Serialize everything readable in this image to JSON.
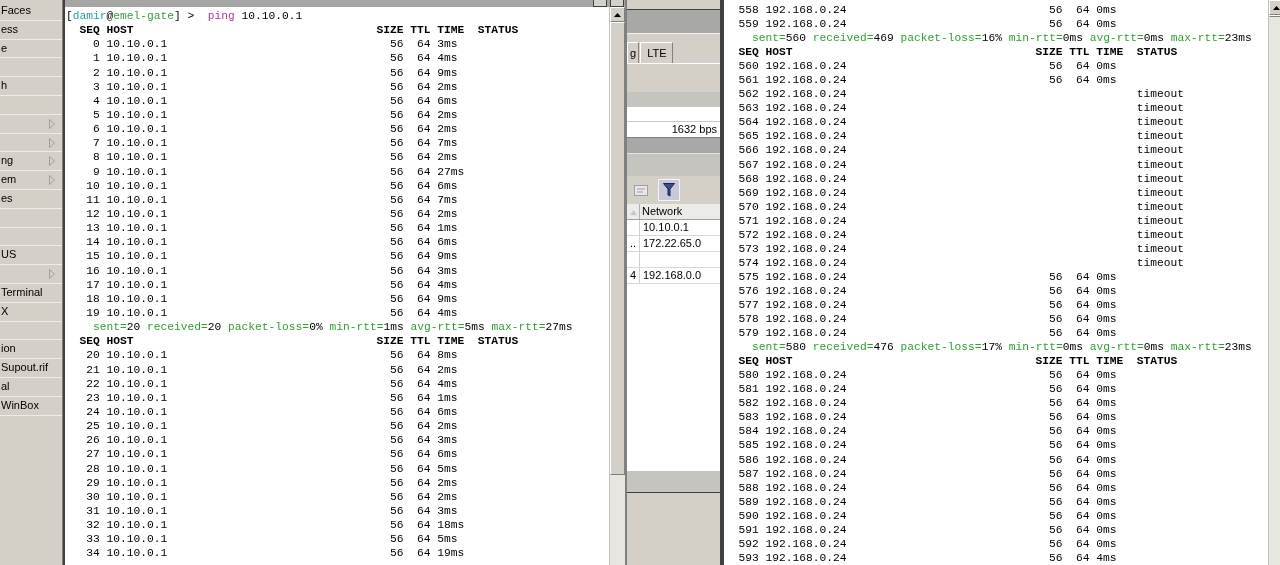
{
  "sidebar": {
    "items": [
      {
        "label": "Faces",
        "submenu": false
      },
      {
        "label": "ess",
        "submenu": false
      },
      {
        "label": "e",
        "submenu": false
      },
      {
        "submenu": false
      },
      {
        "label": "h",
        "submenu": false
      },
      {
        "submenu": false
      },
      {
        "submenu": true
      },
      {
        "submenu": true
      },
      {
        "label": "ng",
        "submenu": true
      },
      {
        "label": "em",
        "submenu": true
      },
      {
        "label": "es",
        "submenu": false
      },
      {
        "submenu": false
      },
      {
        "submenu": false
      },
      {
        "label": "US",
        "submenu": false
      },
      {
        "submenu": true
      },
      {
        "label": "Terminal",
        "submenu": false
      },
      {
        "label": "X",
        "submenu": false
      },
      {
        "submenu": false
      },
      {
        "label": "ion",
        "submenu": false
      },
      {
        "label": "Supout.rif",
        "submenu": false
      },
      {
        "label": "al",
        "submenu": false
      },
      {
        "label": "WinBox",
        "submenu": false
      }
    ]
  },
  "left_terminal": {
    "lines": [
      {
        "kind": "prompt",
        "text": "[damir@emel-gate] >  ping 10.10.0.1"
      },
      {
        "kind": "header",
        "columns": [
          "SEQ",
          "HOST",
          "SIZE",
          "TTL",
          "TIME",
          "STATUS"
        ]
      },
      {
        "kind": "row",
        "seq": "0",
        "host": "10.10.0.1",
        "size": "56",
        "ttl": "64",
        "time": "3ms"
      },
      {
        "kind": "row",
        "seq": "1",
        "host": "10.10.0.1",
        "size": "56",
        "ttl": "64",
        "time": "4ms"
      },
      {
        "kind": "row",
        "seq": "2",
        "host": "10.10.0.1",
        "size": "56",
        "ttl": "64",
        "time": "9ms"
      },
      {
        "kind": "row",
        "seq": "3",
        "host": "10.10.0.1",
        "size": "56",
        "ttl": "64",
        "time": "2ms"
      },
      {
        "kind": "row",
        "seq": "4",
        "host": "10.10.0.1",
        "size": "56",
        "ttl": "64",
        "time": "6ms"
      },
      {
        "kind": "row",
        "seq": "5",
        "host": "10.10.0.1",
        "size": "56",
        "ttl": "64",
        "time": "2ms"
      },
      {
        "kind": "row",
        "seq": "6",
        "host": "10.10.0.1",
        "size": "56",
        "ttl": "64",
        "time": "2ms"
      },
      {
        "kind": "row",
        "seq": "7",
        "host": "10.10.0.1",
        "size": "56",
        "ttl": "64",
        "time": "7ms"
      },
      {
        "kind": "row",
        "seq": "8",
        "host": "10.10.0.1",
        "size": "56",
        "ttl": "64",
        "time": "2ms"
      },
      {
        "kind": "row",
        "seq": "9",
        "host": "10.10.0.1",
        "size": "56",
        "ttl": "64",
        "time": "27ms"
      },
      {
        "kind": "row",
        "seq": "10",
        "host": "10.10.0.1",
        "size": "56",
        "ttl": "64",
        "time": "6ms"
      },
      {
        "kind": "row",
        "seq": "11",
        "host": "10.10.0.1",
        "size": "56",
        "ttl": "64",
        "time": "7ms"
      },
      {
        "kind": "row",
        "seq": "12",
        "host": "10.10.0.1",
        "size": "56",
        "ttl": "64",
        "time": "2ms"
      },
      {
        "kind": "row",
        "seq": "13",
        "host": "10.10.0.1",
        "size": "56",
        "ttl": "64",
        "time": "1ms"
      },
      {
        "kind": "row",
        "seq": "14",
        "host": "10.10.0.1",
        "size": "56",
        "ttl": "64",
        "time": "6ms"
      },
      {
        "kind": "row",
        "seq": "15",
        "host": "10.10.0.1",
        "size": "56",
        "ttl": "64",
        "time": "9ms"
      },
      {
        "kind": "row",
        "seq": "16",
        "host": "10.10.0.1",
        "size": "56",
        "ttl": "64",
        "time": "3ms"
      },
      {
        "kind": "row",
        "seq": "17",
        "host": "10.10.0.1",
        "size": "56",
        "ttl": "64",
        "time": "4ms"
      },
      {
        "kind": "row",
        "seq": "18",
        "host": "10.10.0.1",
        "size": "56",
        "ttl": "64",
        "time": "9ms"
      },
      {
        "kind": "row",
        "seq": "19",
        "host": "10.10.0.1",
        "size": "56",
        "ttl": "64",
        "time": "4ms"
      },
      {
        "kind": "summary",
        "text": "sent=20 received=20 packet-loss=0% min-rtt=1ms avg-rtt=5ms max-rtt=27ms"
      },
      {
        "kind": "header",
        "columns": [
          "SEQ",
          "HOST",
          "SIZE",
          "TTL",
          "TIME",
          "STATUS"
        ]
      },
      {
        "kind": "row",
        "seq": "20",
        "host": "10.10.0.1",
        "size": "56",
        "ttl": "64",
        "time": "8ms"
      },
      {
        "kind": "row",
        "seq": "21",
        "host": "10.10.0.1",
        "size": "56",
        "ttl": "64",
        "time": "2ms"
      },
      {
        "kind": "row",
        "seq": "22",
        "host": "10.10.0.1",
        "size": "56",
        "ttl": "64",
        "time": "4ms"
      },
      {
        "kind": "row",
        "seq": "23",
        "host": "10.10.0.1",
        "size": "56",
        "ttl": "64",
        "time": "1ms"
      },
      {
        "kind": "row",
        "seq": "24",
        "host": "10.10.0.1",
        "size": "56",
        "ttl": "64",
        "time": "6ms"
      },
      {
        "kind": "row",
        "seq": "25",
        "host": "10.10.0.1",
        "size": "56",
        "ttl": "64",
        "time": "2ms"
      },
      {
        "kind": "row",
        "seq": "26",
        "host": "10.10.0.1",
        "size": "56",
        "ttl": "64",
        "time": "3ms"
      },
      {
        "kind": "row",
        "seq": "27",
        "host": "10.10.0.1",
        "size": "56",
        "ttl": "64",
        "time": "6ms"
      },
      {
        "kind": "row",
        "seq": "28",
        "host": "10.10.0.1",
        "size": "56",
        "ttl": "64",
        "time": "5ms"
      },
      {
        "kind": "row",
        "seq": "29",
        "host": "10.10.0.1",
        "size": "56",
        "ttl": "64",
        "time": "2ms"
      },
      {
        "kind": "row",
        "seq": "30",
        "host": "10.10.0.1",
        "size": "56",
        "ttl": "64",
        "time": "2ms"
      },
      {
        "kind": "row",
        "seq": "31",
        "host": "10.10.0.1",
        "size": "56",
        "ttl": "64",
        "time": "3ms"
      },
      {
        "kind": "row",
        "seq": "32",
        "host": "10.10.0.1",
        "size": "56",
        "ttl": "64",
        "time": "18ms"
      },
      {
        "kind": "row",
        "seq": "33",
        "host": "10.10.0.1",
        "size": "56",
        "ttl": "64",
        "time": "5ms"
      },
      {
        "kind": "row",
        "seq": "34",
        "host": "10.10.0.1",
        "size": "56",
        "ttl": "64",
        "time": "19ms"
      }
    ]
  },
  "background_window": {
    "tabs": [
      {
        "label": "g",
        "selected": false
      },
      {
        "label": "LTE",
        "selected": false
      }
    ],
    "rate": "1632 bps",
    "table": {
      "columns": [
        {
          "label": "Network"
        }
      ],
      "rows": [
        {
          "network": "10.10.0.1"
        },
        {
          "column_1": "..",
          "network": "172.22.65.0"
        },
        {},
        {
          "column_1": "4",
          "network": "192.168.0.0"
        }
      ]
    }
  },
  "right_terminal": {
    "lines": [
      {
        "kind": "row",
        "seq": "558",
        "host": "192.168.0.24",
        "size": "56",
        "ttl": "64",
        "time": "0ms"
      },
      {
        "kind": "row",
        "seq": "559",
        "host": "192.168.0.24",
        "size": "56",
        "ttl": "64",
        "time": "0ms"
      },
      {
        "kind": "summary",
        "text": "sent=560 received=469 packet-loss=16% min-rtt=0ms avg-rtt=0ms max-rtt=23ms"
      },
      {
        "kind": "header",
        "columns": [
          "SEQ",
          "HOST",
          "SIZE",
          "TTL",
          "TIME",
          "STATUS"
        ]
      },
      {
        "kind": "row",
        "seq": "560",
        "host": "192.168.0.24",
        "size": "56",
        "ttl": "64",
        "time": "0ms"
      },
      {
        "kind": "row",
        "seq": "561",
        "host": "192.168.0.24",
        "size": "56",
        "ttl": "64",
        "time": "0ms"
      },
      {
        "kind": "row",
        "seq": "562",
        "host": "192.168.0.24",
        "status": "timeout"
      },
      {
        "kind": "row",
        "seq": "563",
        "host": "192.168.0.24",
        "status": "timeout"
      },
      {
        "kind": "row",
        "seq": "564",
        "host": "192.168.0.24",
        "status": "timeout"
      },
      {
        "kind": "row",
        "seq": "565",
        "host": "192.168.0.24",
        "status": "timeout"
      },
      {
        "kind": "row",
        "seq": "566",
        "host": "192.168.0.24",
        "status": "timeout"
      },
      {
        "kind": "row",
        "seq": "567",
        "host": "192.168.0.24",
        "status": "timeout"
      },
      {
        "kind": "row",
        "seq": "568",
        "host": "192.168.0.24",
        "status": "timeout"
      },
      {
        "kind": "row",
        "seq": "569",
        "host": "192.168.0.24",
        "status": "timeout"
      },
      {
        "kind": "row",
        "seq": "570",
        "host": "192.168.0.24",
        "status": "timeout"
      },
      {
        "kind": "row",
        "seq": "571",
        "host": "192.168.0.24",
        "status": "timeout"
      },
      {
        "kind": "row",
        "seq": "572",
        "host": "192.168.0.24",
        "status": "timeout"
      },
      {
        "kind": "row",
        "seq": "573",
        "host": "192.168.0.24",
        "status": "timeout"
      },
      {
        "kind": "row",
        "seq": "574",
        "host": "192.168.0.24",
        "status": "timeout"
      },
      {
        "kind": "row",
        "seq": "575",
        "host": "192.168.0.24",
        "size": "56",
        "ttl": "64",
        "time": "0ms"
      },
      {
        "kind": "row",
        "seq": "576",
        "host": "192.168.0.24",
        "size": "56",
        "ttl": "64",
        "time": "0ms"
      },
      {
        "kind": "row",
        "seq": "577",
        "host": "192.168.0.24",
        "size": "56",
        "ttl": "64",
        "time": "0ms"
      },
      {
        "kind": "row",
        "seq": "578",
        "host": "192.168.0.24",
        "size": "56",
        "ttl": "64",
        "time": "0ms"
      },
      {
        "kind": "row",
        "seq": "579",
        "host": "192.168.0.24",
        "size": "56",
        "ttl": "64",
        "time": "0ms"
      },
      {
        "kind": "summary",
        "text": "sent=580 received=476 packet-loss=17% min-rtt=0ms avg-rtt=0ms max-rtt=23ms"
      },
      {
        "kind": "header",
        "columns": [
          "SEQ",
          "HOST",
          "SIZE",
          "TTL",
          "TIME",
          "STATUS"
        ]
      },
      {
        "kind": "row",
        "seq": "580",
        "host": "192.168.0.24",
        "size": "56",
        "ttl": "64",
        "time": "0ms"
      },
      {
        "kind": "row",
        "seq": "581",
        "host": "192.168.0.24",
        "size": "56",
        "ttl": "64",
        "time": "0ms"
      },
      {
        "kind": "row",
        "seq": "582",
        "host": "192.168.0.24",
        "size": "56",
        "ttl": "64",
        "time": "0ms"
      },
      {
        "kind": "row",
        "seq": "583",
        "host": "192.168.0.24",
        "size": "56",
        "ttl": "64",
        "time": "0ms"
      },
      {
        "kind": "row",
        "seq": "584",
        "host": "192.168.0.24",
        "size": "56",
        "ttl": "64",
        "time": "0ms"
      },
      {
        "kind": "row",
        "seq": "585",
        "host": "192.168.0.24",
        "size": "56",
        "ttl": "64",
        "time": "0ms"
      },
      {
        "kind": "row",
        "seq": "586",
        "host": "192.168.0.24",
        "size": "56",
        "ttl": "64",
        "time": "0ms"
      },
      {
        "kind": "row",
        "seq": "587",
        "host": "192.168.0.24",
        "size": "56",
        "ttl": "64",
        "time": "0ms"
      },
      {
        "kind": "row",
        "seq": "588",
        "host": "192.168.0.24",
        "size": "56",
        "ttl": "64",
        "time": "0ms"
      },
      {
        "kind": "row",
        "seq": "589",
        "host": "192.168.0.24",
        "size": "56",
        "ttl": "64",
        "time": "0ms"
      },
      {
        "kind": "row",
        "seq": "590",
        "host": "192.168.0.24",
        "size": "56",
        "ttl": "64",
        "time": "0ms"
      },
      {
        "kind": "row",
        "seq": "591",
        "host": "192.168.0.24",
        "size": "56",
        "ttl": "64",
        "time": "0ms"
      },
      {
        "kind": "row",
        "seq": "592",
        "host": "192.168.0.24",
        "size": "56",
        "ttl": "64",
        "time": "0ms"
      },
      {
        "kind": "row",
        "seq": "593",
        "host": "192.168.0.24",
        "size": "56",
        "ttl": "64",
        "time": "4ms"
      }
    ]
  }
}
